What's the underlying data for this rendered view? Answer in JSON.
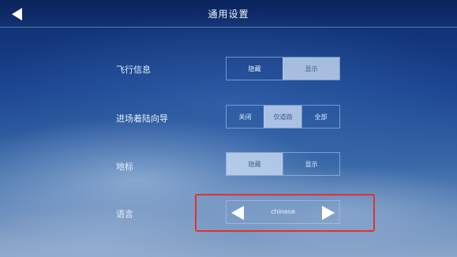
{
  "header": {
    "title": "通用设置"
  },
  "settings": {
    "flight_info": {
      "label": "飞行信息",
      "options": [
        "隐藏",
        "显示"
      ],
      "selected": "显示"
    },
    "approach_direction": {
      "label": "进场着陆向导",
      "options": [
        "关闭",
        "仅道路",
        "全部"
      ],
      "selected": "仅道路"
    },
    "landmark": {
      "label": "地标",
      "options": [
        "隐藏",
        "显示"
      ],
      "selected": "隐藏"
    },
    "language": {
      "label": "语言",
      "value": "chinese"
    }
  },
  "colors": {
    "highlight_border": "#e0322f",
    "active_segment": "#cddef5"
  },
  "icons": {
    "back": "triangle-left-icon",
    "prev": "triangle-left-icon",
    "next": "triangle-right-icon"
  }
}
